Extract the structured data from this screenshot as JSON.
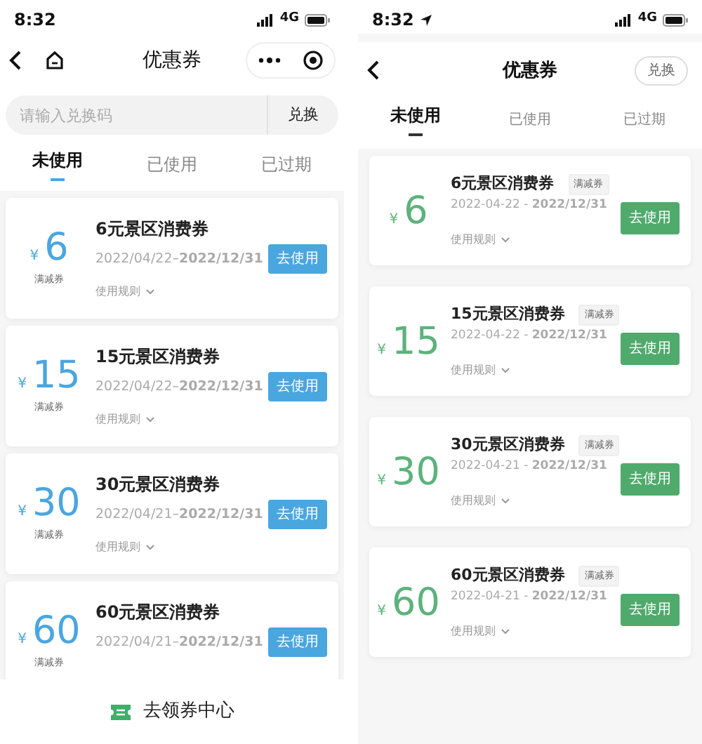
{
  "screens": [
    {
      "kind": "stacked",
      "status_bar": {
        "time": "8:32",
        "location": false,
        "network": "4G"
      },
      "nav": {
        "title": "优惠券",
        "home": true,
        "capsule": true
      },
      "search": {
        "placeholder": "请输入兑换码",
        "button": "兑换"
      },
      "tabs": [
        {
          "label": "未使用",
          "selected": true
        },
        {
          "label": "已使用",
          "selected": false
        },
        {
          "label": "已过期",
          "selected": false
        }
      ],
      "coupons": [
        {
          "currency": "¥",
          "amount": "6",
          "tag": "满减券",
          "title": "6元景区消费券",
          "validity": "2022/04/22–**2022/12/31**",
          "rules": "使用规则",
          "button": "去使用"
        },
        {
          "currency": "¥",
          "amount": "15",
          "tag": "满减券",
          "title": "15元景区消费券",
          "validity": "2022/04/22–**2022/12/31**",
          "rules": "使用规则",
          "button": "去使用"
        },
        {
          "currency": "¥",
          "amount": "30",
          "tag": "满减券",
          "title": "30元景区消费券",
          "validity": "2022/04/21–**2022/12/31**",
          "rules": "使用规则",
          "button": "去使用"
        },
        {
          "currency": "¥",
          "amount": "60",
          "tag": "满减券",
          "title": "60元景区消费券",
          "validity": "2022/04/21–**2022/12/31**",
          "button": "去使用"
        }
      ],
      "bottom_bar": {
        "label": "去领券中心"
      }
    },
    {
      "kind": "inline",
      "status_bar": {
        "time": "8:32",
        "location": true,
        "network": "4G"
      },
      "nav": {
        "title": "优惠券",
        "home": false,
        "capsule": false,
        "action": "兑换"
      },
      "tabs": [
        {
          "label": "未使用",
          "selected": true
        },
        {
          "label": "已使用",
          "selected": false
        },
        {
          "label": "已过期",
          "selected": false
        }
      ],
      "coupons": [
        {
          "currency": "¥",
          "amount": "6",
          "tag": "满减券",
          "title": "6元景区消费券",
          "validity": "2022-04-22 - **2022/12/31**",
          "rules": "使用规则",
          "button": "去使用"
        },
        {
          "currency": "¥",
          "amount": "15",
          "tag": "满减券",
          "title": "15元景区消费券",
          "validity": "2022-04-22 - **2022/12/31**",
          "rules": "使用规则",
          "button": "去使用"
        },
        {
          "currency": "¥",
          "amount": "30",
          "tag": "满减券",
          "title": "30元景区消费券",
          "validity": "2022-04-21 - **2022/12/31**",
          "rules": "使用规则",
          "button": "去使用"
        },
        {
          "currency": "¥",
          "amount": "60",
          "tag": "满减券",
          "title": "60元景区消费券",
          "validity": "2022-04-21 - **2022/12/31**",
          "rules": "使用规则",
          "button": "去使用"
        }
      ]
    }
  ]
}
